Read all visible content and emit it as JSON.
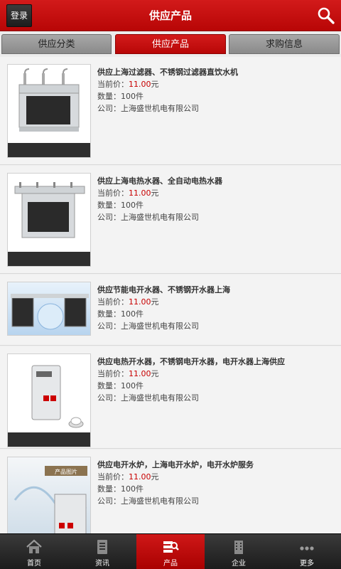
{
  "header": {
    "login_label": "登录",
    "title": "供应产品",
    "search_icon": "search-icon"
  },
  "tabs": [
    {
      "label": "供应分类",
      "active": false
    },
    {
      "label": "供应产品",
      "active": true
    },
    {
      "label": "求购信息",
      "active": false
    }
  ],
  "colors": {
    "brand_red": "#c00000",
    "price_red": "#c80000",
    "nav_dark": "#2a2a2a"
  },
  "products": [
    {
      "title": "供应上海过滤器、不锈钢过滤器直饮水机",
      "price_label": "当前价：",
      "price": "11.00",
      "price_unit": "元",
      "qty_label": "数量：",
      "qty": "100件",
      "company_label": "公司：",
      "company": "上海盛世机电有限公司"
    },
    {
      "title": "供应上海电热水器、全自动电热水器",
      "price_label": "当前价：",
      "price": "11.00",
      "price_unit": "元",
      "qty_label": "数量：",
      "qty": "100件",
      "company_label": "公司：",
      "company": "上海盛世机电有限公司"
    },
    {
      "title": "供应节能电开水器、不锈钢开水器上海",
      "price_label": "当前价：",
      "price": "11.00",
      "price_unit": "元",
      "qty_label": "数量：",
      "qty": "100件",
      "company_label": "公司：",
      "company": "上海盛世机电有限公司"
    },
    {
      "title": "供应电热开水器，不锈钢电开水器，电开水器上海供应",
      "price_label": "当前价：",
      "price": "11.00",
      "price_unit": "元",
      "qty_label": "数量：",
      "qty": "100件",
      "company_label": "公司：",
      "company": "上海盛世机电有限公司"
    },
    {
      "title": "供应电开水炉，上海电开水炉，电开水炉服务",
      "price_label": "当前价：",
      "price": "11.00",
      "price_unit": "元",
      "qty_label": "数量：",
      "qty": "100件",
      "company_label": "公司：",
      "company": "上海盛世机电有限公司",
      "image_caption": "产品图片"
    }
  ],
  "bottom_nav": [
    {
      "label": "首页",
      "icon": "home-icon",
      "active": false
    },
    {
      "label": "资讯",
      "icon": "news-icon",
      "active": false
    },
    {
      "label": "产品",
      "icon": "product-icon",
      "active": true
    },
    {
      "label": "企业",
      "icon": "building-icon",
      "active": false
    },
    {
      "label": "更多",
      "icon": "more-icon",
      "active": false
    }
  ]
}
